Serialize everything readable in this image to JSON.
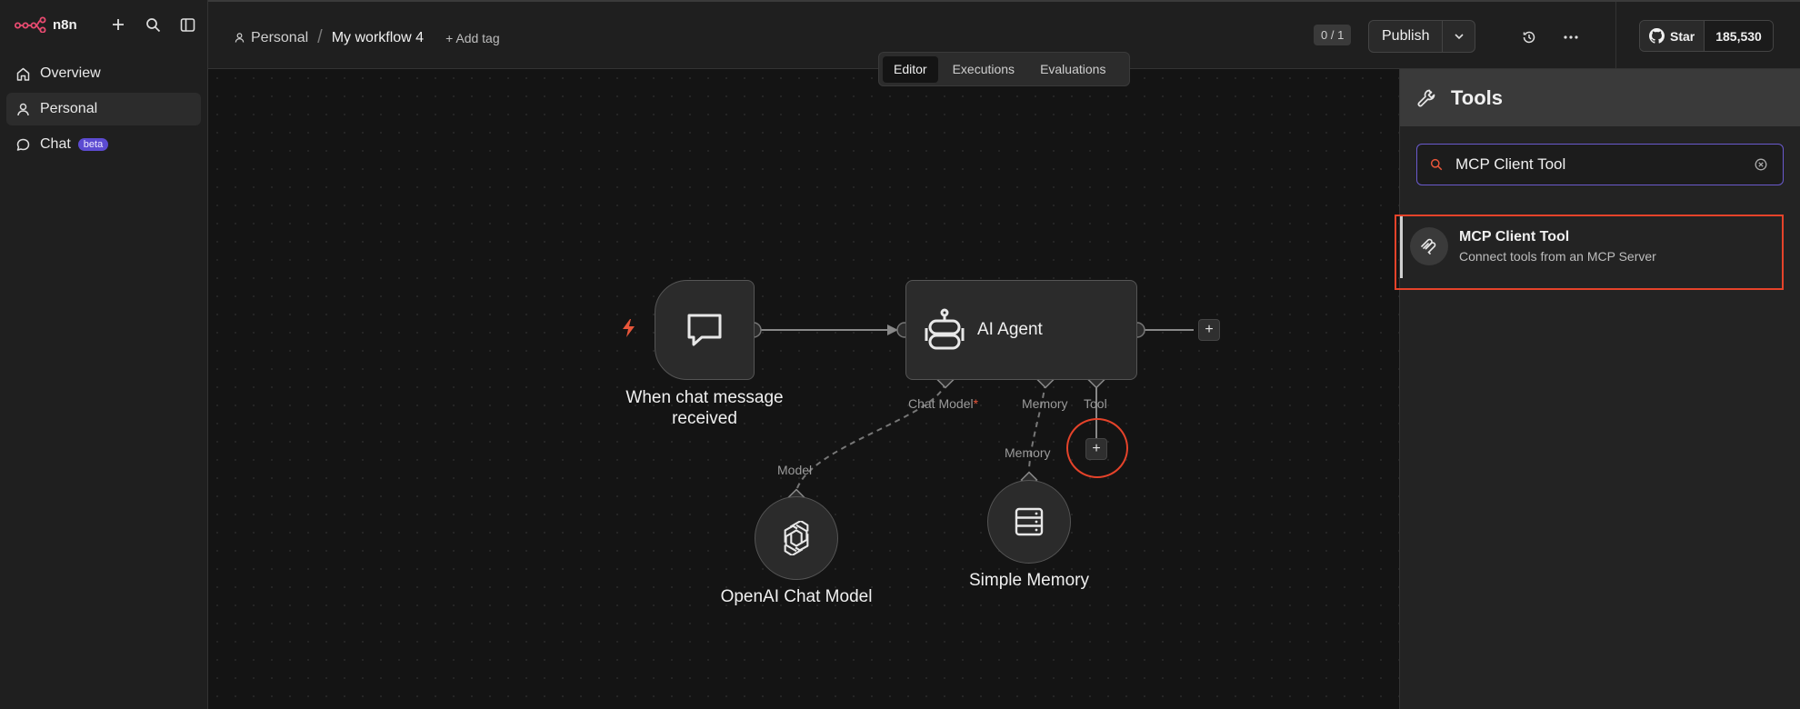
{
  "sidebar": {
    "brand": "n8n",
    "items": [
      {
        "label": "Overview",
        "icon": "home-icon"
      },
      {
        "label": "Personal",
        "icon": "user-icon"
      },
      {
        "label": "Chat",
        "icon": "chat-icon",
        "badge": "beta"
      }
    ]
  },
  "header": {
    "breadcrumb_project": "Personal",
    "separator": "/",
    "workflow_name": "My workflow 4",
    "add_tag": "+ Add tag",
    "counter": "0 / 1",
    "publish": "Publish",
    "github_star": "Star",
    "github_count": "185,530"
  },
  "tabs": [
    {
      "label": "Editor",
      "active": true
    },
    {
      "label": "Executions",
      "active": false
    },
    {
      "label": "Evaluations",
      "active": false
    }
  ],
  "canvas": {
    "trigger_label_line1": "When chat message",
    "trigger_label_line2": "received",
    "agent_label": "AI Agent",
    "port_chat_model": "Chat Model",
    "required_marker": "*",
    "port_memory": "Memory",
    "port_tool": "Tool",
    "model_port": "Model",
    "memory_port": "Memory",
    "openai_label": "OpenAI Chat Model",
    "memory_label": "Simple Memory",
    "plus": "+"
  },
  "panel": {
    "title": "Tools",
    "search_value": "MCP Client Tool",
    "results": [
      {
        "title": "MCP Client Tool",
        "description": "Connect tools from an MCP Server",
        "icon": "mcp-icon"
      }
    ]
  },
  "colors": {
    "accent": "#6a5acd",
    "highlight": "#e5432a",
    "trigger_bolt": "#e8563a"
  }
}
